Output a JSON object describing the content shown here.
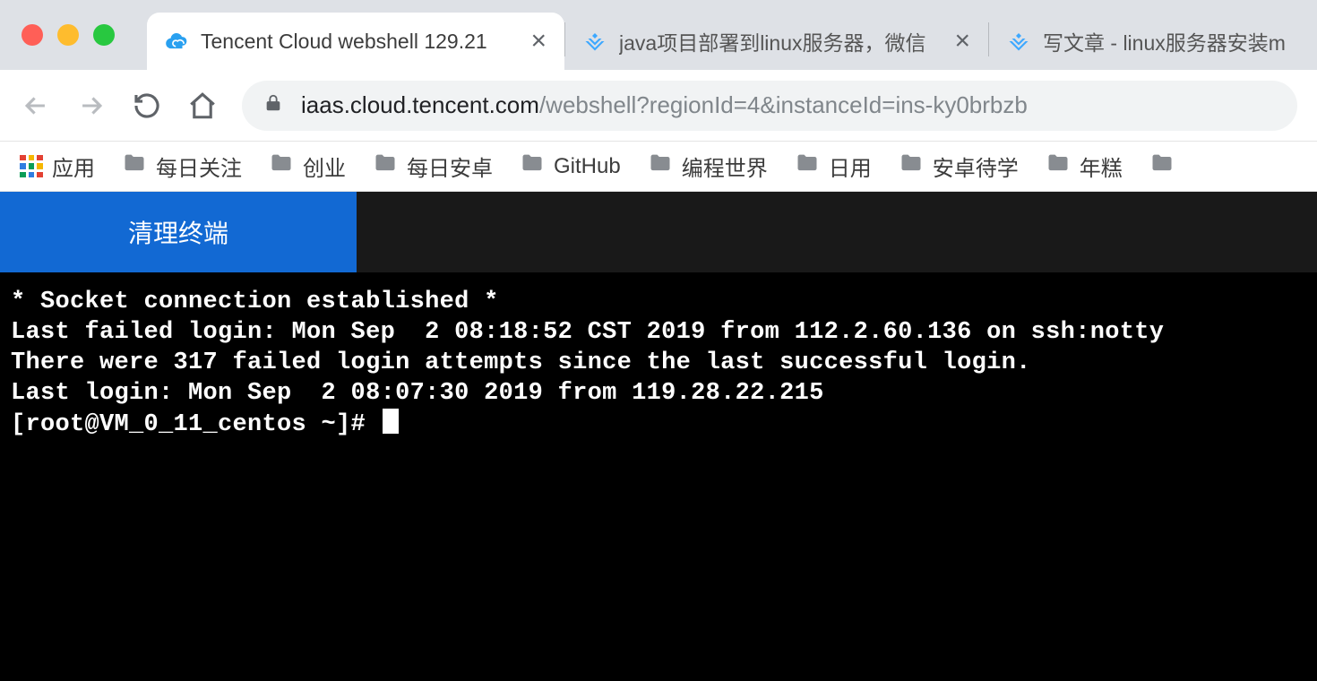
{
  "tabs": [
    {
      "title": "Tencent Cloud webshell 129.21",
      "active": true,
      "favicon": "cloud"
    },
    {
      "title": "java项目部署到linux服务器，微信",
      "active": false,
      "favicon": "juejin"
    },
    {
      "title": "写文章 - linux服务器安装m",
      "active": false,
      "favicon": "juejin"
    }
  ],
  "addressbar": {
    "host": "iaas.cloud.tencent.com",
    "path": "/webshell?regionId=4&instanceId=ins-ky0brbzb"
  },
  "bookmarks": {
    "apps_label": "应用",
    "folders": [
      "每日关注",
      "创业",
      "每日安卓",
      "GitHub",
      "编程世界",
      "日用",
      "安卓待学",
      "年糕"
    ]
  },
  "action_button": "清理终端",
  "terminal_lines": [
    "* Socket connection established *",
    "Last failed login: Mon Sep  2 08:18:52 CST 2019 from 112.2.60.136 on ssh:notty",
    "There were 317 failed login attempts since the last successful login.",
    "Last login: Mon Sep  2 08:07:30 2019 from 119.28.22.215"
  ],
  "terminal_prompt": "[root@VM_0_11_centos ~]# "
}
